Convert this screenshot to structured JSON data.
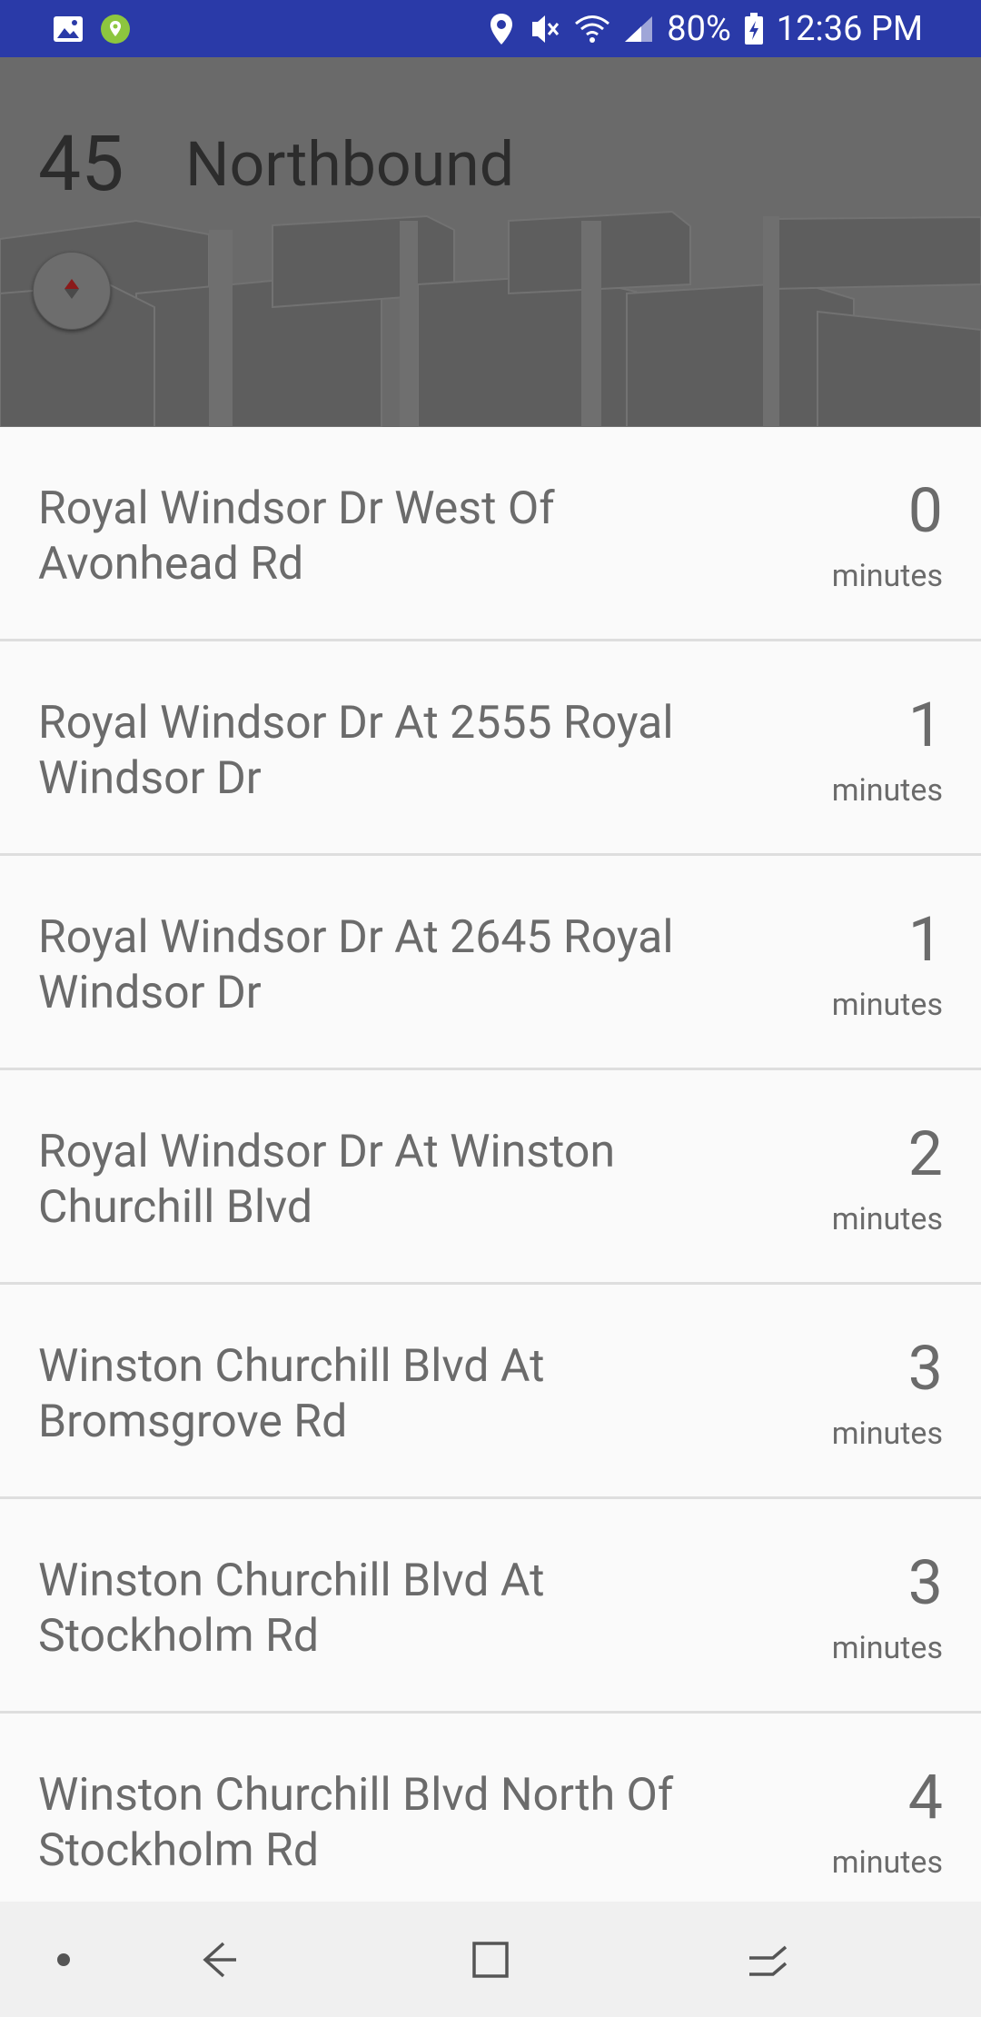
{
  "status_bar": {
    "battery": "80%",
    "time": "12:36 PM",
    "icons": [
      "gallery-icon",
      "location-app-icon",
      "location-icon",
      "vibrate-mute-icon",
      "wifi-icon",
      "signal-icon",
      "battery-charging-icon"
    ]
  },
  "header": {
    "route_number": "45",
    "direction": "Northbound",
    "compass_icon": "compass-icon"
  },
  "stops": [
    {
      "name": "Royal Windsor Dr West Of Avonhead Rd",
      "eta": "0",
      "unit": "minutes"
    },
    {
      "name": "Royal Windsor Dr At 2555 Royal Windsor Dr",
      "eta": "1",
      "unit": "minutes"
    },
    {
      "name": "Royal Windsor Dr At 2645 Royal Windsor Dr",
      "eta": "1",
      "unit": "minutes"
    },
    {
      "name": "Royal Windsor Dr At Winston Churchill Blvd",
      "eta": "2",
      "unit": "minutes"
    },
    {
      "name": "Winston Churchill Blvd At Bromsgrove Rd",
      "eta": "3",
      "unit": "minutes"
    },
    {
      "name": "Winston Churchill Blvd At Stockholm Rd",
      "eta": "3",
      "unit": "minutes"
    },
    {
      "name": "Winston Churchill Blvd North Of Stockholm Rd",
      "eta": "4",
      "unit": "minutes"
    }
  ],
  "navbar": {
    "items": [
      "dot-icon",
      "back-icon",
      "home-icon",
      "recents-icon"
    ]
  },
  "colors": {
    "status_bar": "#2a3aa8",
    "header_bg": "#6a6a6a",
    "list_bg": "#fafafa",
    "text": "#6b6b6b",
    "divider": "#dedede",
    "compass_accent": "#8b1a1a"
  }
}
